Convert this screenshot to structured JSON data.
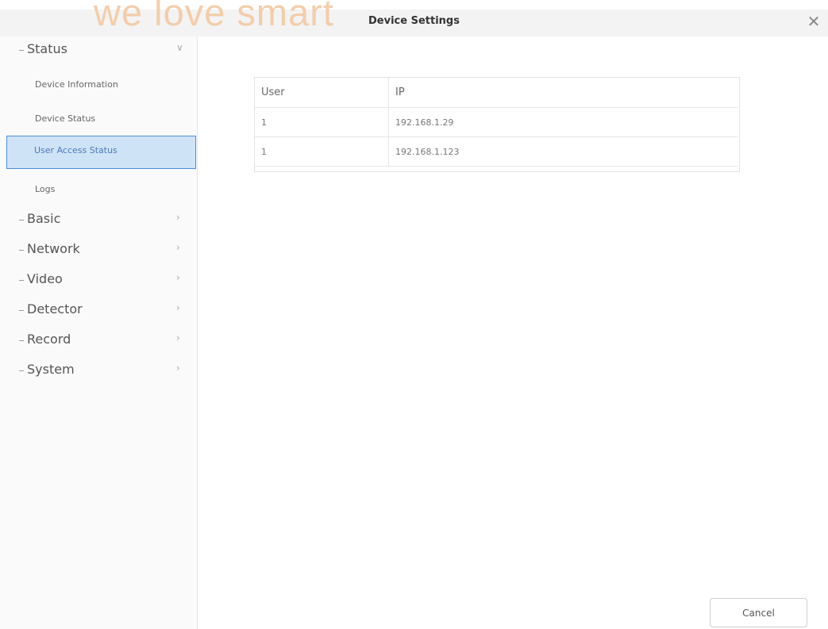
{
  "header": {
    "watermark": "we love smart",
    "title": "Device Settings",
    "close_icon": "close-icon"
  },
  "sidebar": {
    "groups": [
      {
        "label": "Status",
        "expanded": true,
        "items": [
          {
            "label": "Device Information"
          },
          {
            "label": "Device Status"
          },
          {
            "label": "User Access Status",
            "active": true
          },
          {
            "label": "Logs"
          }
        ]
      },
      {
        "label": "Basic"
      },
      {
        "label": "Network"
      },
      {
        "label": "Video"
      },
      {
        "label": "Detector"
      },
      {
        "label": "Record"
      },
      {
        "label": "System"
      }
    ],
    "chevron_down": "chevron-down-icon",
    "chevron_right": "chevron-right-icon"
  },
  "main": {
    "table": {
      "headers": [
        "User",
        "IP"
      ],
      "rows": [
        [
          "1",
          "192.168.1.29"
        ],
        [
          "1",
          "192.168.1.123"
        ]
      ]
    }
  },
  "footer": {
    "cancel_label": "Cancel"
  },
  "colors": {
    "accent": "#4a90d9",
    "active_bg": "#cfe3f7",
    "watermark": "#f3c9a3"
  }
}
